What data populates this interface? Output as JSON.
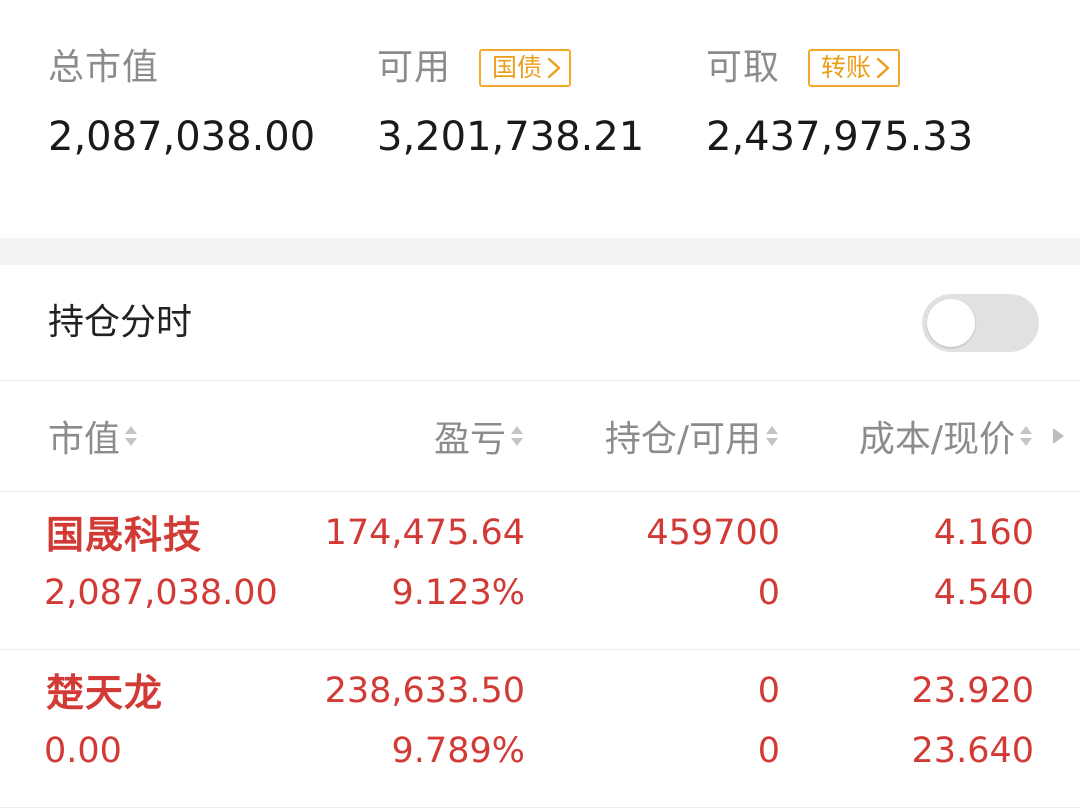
{
  "summary": {
    "total_market_value": {
      "label": "总市值",
      "value": "2,087,038.00"
    },
    "available": {
      "label": "可用",
      "tag": "国债",
      "value": "3,201,738.21"
    },
    "withdrawable": {
      "label": "可取",
      "tag": "转账",
      "value": "2,437,975.33"
    }
  },
  "toggle": {
    "label": "持仓分时",
    "enabled": false
  },
  "table": {
    "headers": [
      "市值",
      "盈亏",
      "持仓/可用",
      "成本/现价"
    ],
    "rows": [
      {
        "name": "国晟科技",
        "market_value": "2,087,038.00",
        "profit": "174,475.64",
        "profit_pct": "9.123%",
        "holding": "459700",
        "available": "0",
        "cost": "4.160",
        "price": "4.540"
      },
      {
        "name": "楚天龙",
        "market_value": "0.00",
        "profit": "238,633.50",
        "profit_pct": "9.789%",
        "holding": "0",
        "available": "0",
        "cost": "23.920",
        "price": "23.640"
      }
    ]
  },
  "colors": {
    "up_red": "#d23a35",
    "tag_orange": "#eb9e1a",
    "label_gray": "#8c8c8c",
    "toggle_off": "#e1e1e1"
  },
  "icons": {
    "tag_arrow": "chevron-right-icon",
    "sort": "sort-updown-icon",
    "more": "triangle-right-icon"
  }
}
